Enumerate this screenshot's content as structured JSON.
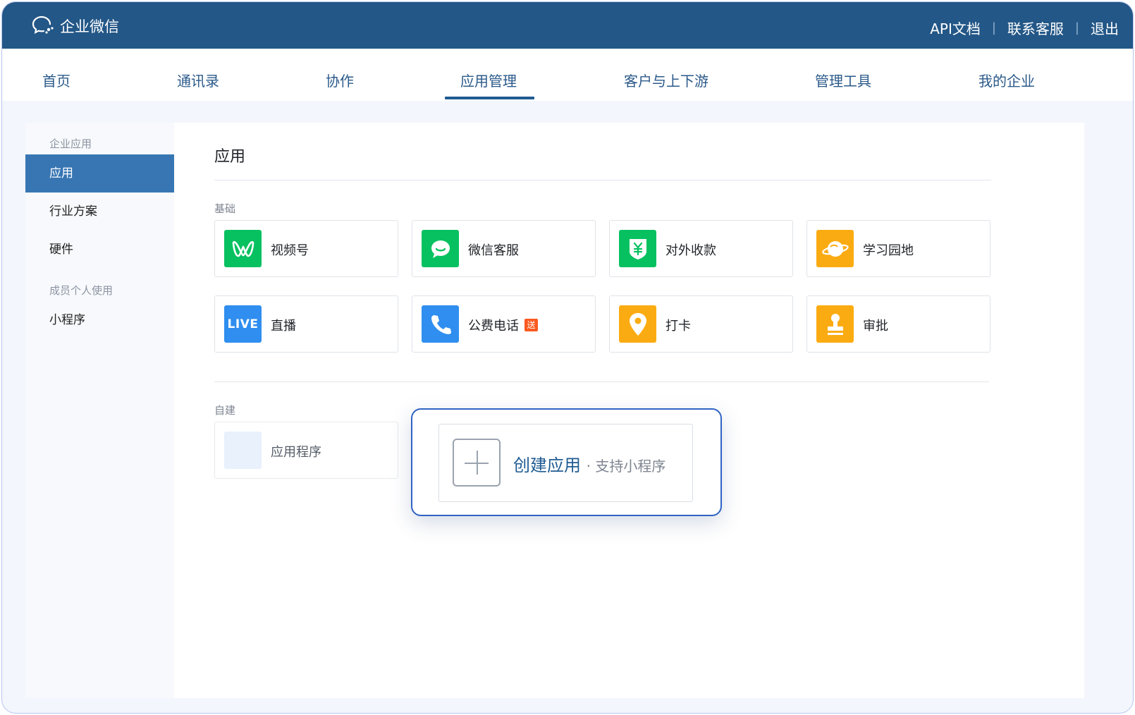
{
  "header": {
    "app_name": "企业微信",
    "links": [
      "API文档",
      "联系客服",
      "退出"
    ]
  },
  "nav": {
    "items": [
      "首页",
      "通讯录",
      "协作",
      "应用管理",
      "客户与上下游",
      "管理工具",
      "我的企业"
    ],
    "active": "应用管理"
  },
  "sidebar": {
    "group1": "企业应用",
    "items1": [
      "应用",
      "行业方案",
      "硬件"
    ],
    "group2": "成员个人使用",
    "items2": [
      "小程序"
    ],
    "active": "应用"
  },
  "main": {
    "title": "应用",
    "basic_label": "基础",
    "apps": [
      {
        "name": "视频号",
        "icon": "channels-icon",
        "color": "#07c160"
      },
      {
        "name": "微信客服",
        "icon": "chat-bubble-icon",
        "color": "#07c160"
      },
      {
        "name": "对外收款",
        "icon": "yuan-shield-icon",
        "color": "#07c160"
      },
      {
        "name": "学习园地",
        "icon": "planet-icon",
        "color": "#fbab12"
      },
      {
        "name": "直播",
        "icon": "live-icon",
        "color": "#2f8eef"
      },
      {
        "name": "公费电话",
        "icon": "phone-icon",
        "color": "#2f8eef",
        "badge": "送"
      },
      {
        "name": "打卡",
        "icon": "location-pin-icon",
        "color": "#fbab12"
      },
      {
        "name": "审批",
        "icon": "stamp-icon",
        "color": "#fbab12"
      }
    ],
    "custom_label": "自建",
    "custom_app": "应用程序"
  },
  "popup": {
    "create_label": "创建应用",
    "create_sub": "· 支持小程序"
  }
}
